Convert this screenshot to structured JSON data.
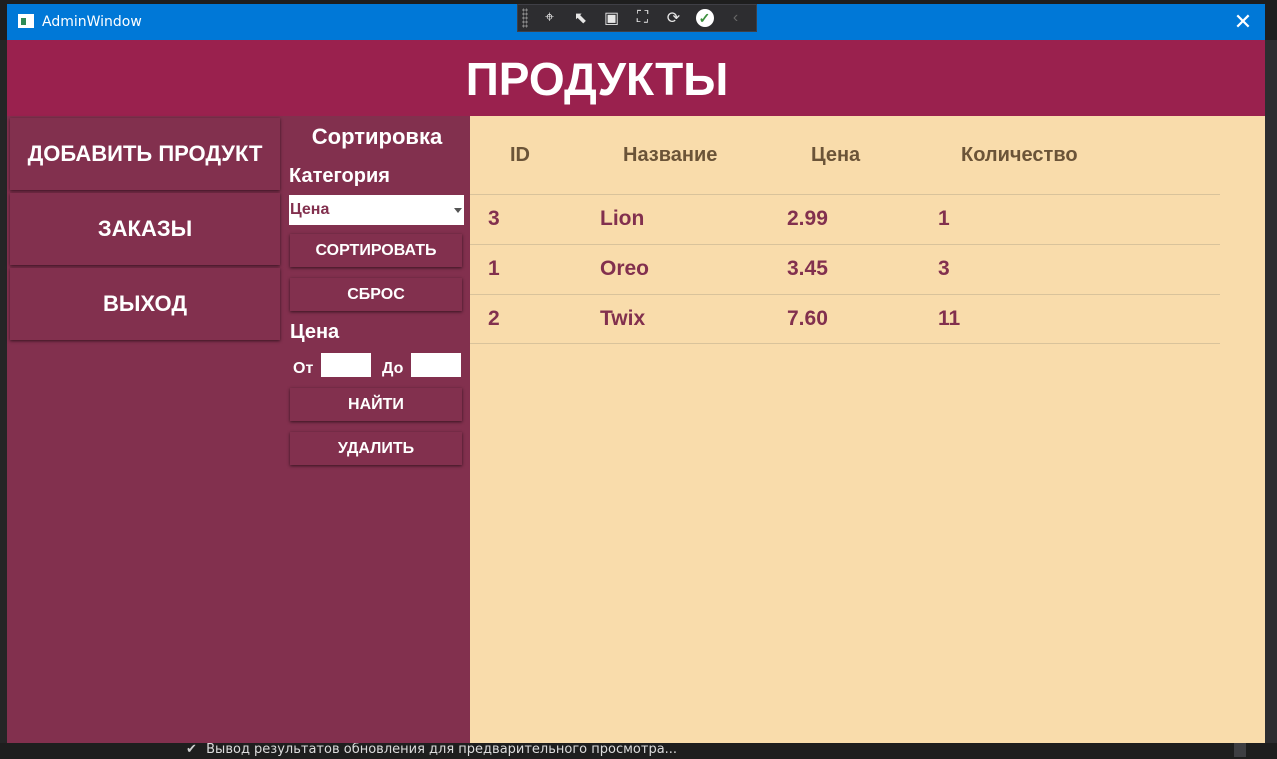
{
  "window": {
    "title": "AdminWindow"
  },
  "debug_toolbar": {
    "icons": [
      "select-element-icon",
      "pointer-icon",
      "frame-icon",
      "track-focus-icon",
      "hot-reload-icon",
      "check-icon",
      "collapse-icon"
    ]
  },
  "header": {
    "title": "ПРОДУКТЫ"
  },
  "nav": {
    "add_product": "ДОБАВИТЬ ПРОДУКТ",
    "orders": "ЗАКАЗЫ",
    "exit": "ВЫХОД"
  },
  "sort": {
    "title": "Сортировка",
    "category_label": "Категория",
    "selected": "Цена",
    "sort_button": "СОРТИРОВАТЬ",
    "reset_button": "СБРОС"
  },
  "price": {
    "label": "Цена",
    "from_label": "От",
    "to_label": "До",
    "from_value": "",
    "to_value": "",
    "find_button": "НАЙТИ",
    "delete_button": "УДАЛИТЬ"
  },
  "table": {
    "headers": [
      "ID",
      "Название",
      "Цена",
      "Количество"
    ],
    "rows": [
      [
        "3",
        "Lion",
        "2.99",
        "1"
      ],
      [
        "1",
        "Oreo",
        "3.45",
        "3"
      ],
      [
        "2",
        "Twix",
        "7.60",
        "11"
      ]
    ]
  },
  "ide": {
    "status": "Вывод результатов обновления для предварительного просмотра..."
  },
  "colors": {
    "titlebar": "#0078d7",
    "header": "#9a214e",
    "sidebar": "#82304e",
    "table_bg": "#f9dcab",
    "cell_text": "#82304e",
    "header_text": "#6b5438"
  }
}
